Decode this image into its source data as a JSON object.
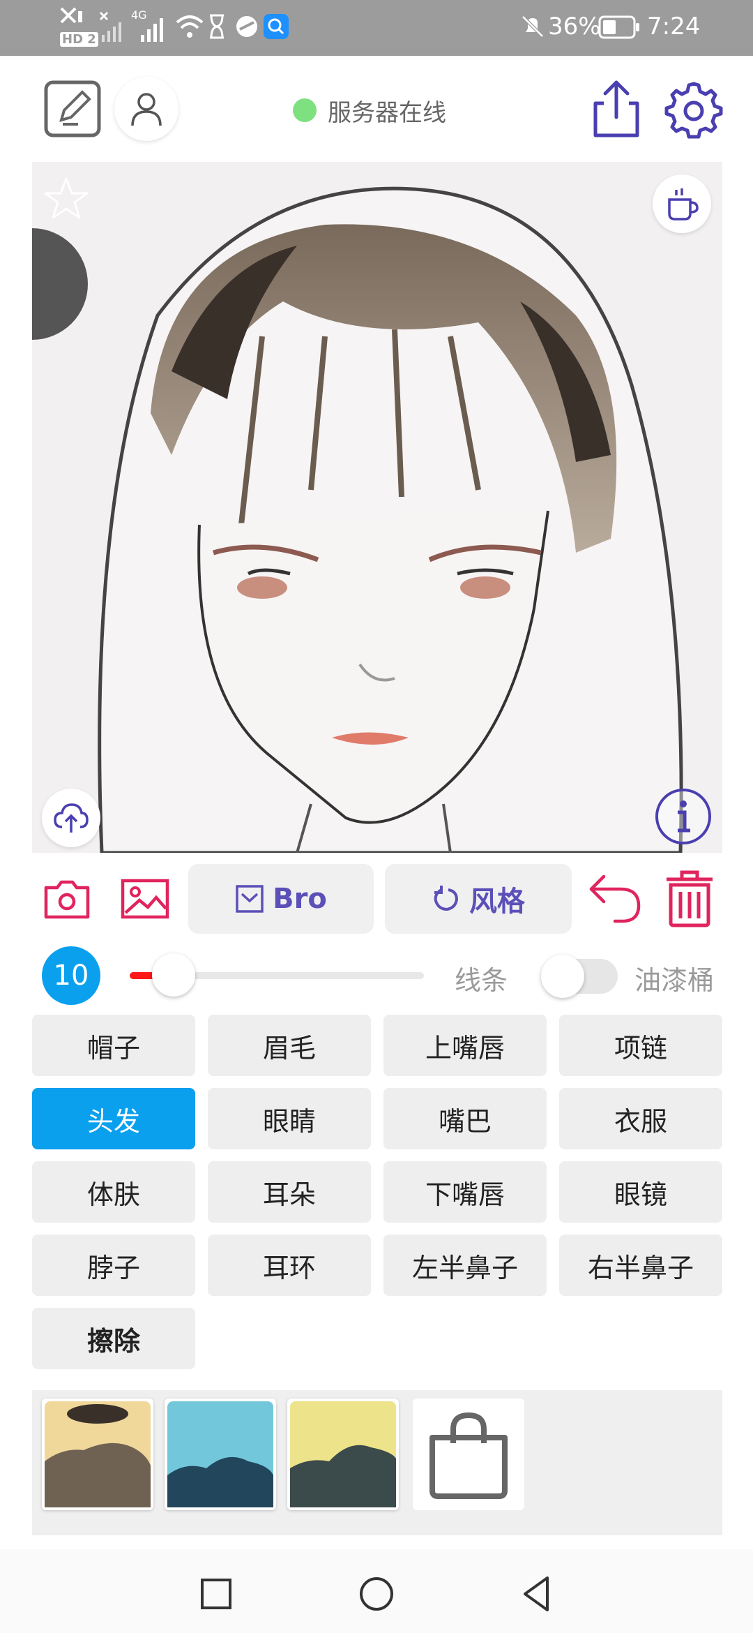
{
  "status_bar": {
    "network_badge": "HD 2",
    "signal_label": "4G",
    "battery_percent": "36%",
    "time": "7:24"
  },
  "header": {
    "server_status": "服务器在线",
    "status_color": "#7fe07f",
    "accent_color": "#4a3fb0",
    "icons": [
      "edit-icon",
      "user-icon",
      "share-icon",
      "settings-icon"
    ]
  },
  "canvas": {
    "overlay_icons": [
      "star-icon",
      "coffee-icon",
      "cloud-upload-icon",
      "info-icon"
    ]
  },
  "toolbar": {
    "bro_label": "Bro",
    "style_label": "风格",
    "icons": [
      "camera-icon",
      "image-icon",
      "undo-icon",
      "trash-icon"
    ],
    "accent": "#e0245e"
  },
  "brush": {
    "size": "10",
    "slider_fraction": 0.12,
    "lines_label": "线条",
    "bucket_label": "油漆桶",
    "bucket_enabled": false
  },
  "parts": [
    {
      "label": "帽子"
    },
    {
      "label": "眉毛"
    },
    {
      "label": "上嘴唇"
    },
    {
      "label": "项链"
    },
    {
      "label": "头发",
      "selected": true
    },
    {
      "label": "眼睛"
    },
    {
      "label": "嘴巴"
    },
    {
      "label": "衣服"
    },
    {
      "label": "体肤"
    },
    {
      "label": "耳朵"
    },
    {
      "label": "下嘴唇"
    },
    {
      "label": "眼镜"
    },
    {
      "label": "脖子"
    },
    {
      "label": "耳环"
    },
    {
      "label": "左半鼻子"
    },
    {
      "label": "右半鼻子"
    },
    {
      "label": "擦除"
    }
  ],
  "selected_color": "#0aa0ee",
  "swatches": [
    {
      "name": "preset-1"
    },
    {
      "name": "preset-2"
    },
    {
      "name": "preset-3"
    },
    {
      "name": "shop",
      "icon": "shopping-bag-icon"
    }
  ],
  "nav": {
    "icons": [
      "recent-apps-icon",
      "home-icon",
      "back-icon"
    ]
  }
}
